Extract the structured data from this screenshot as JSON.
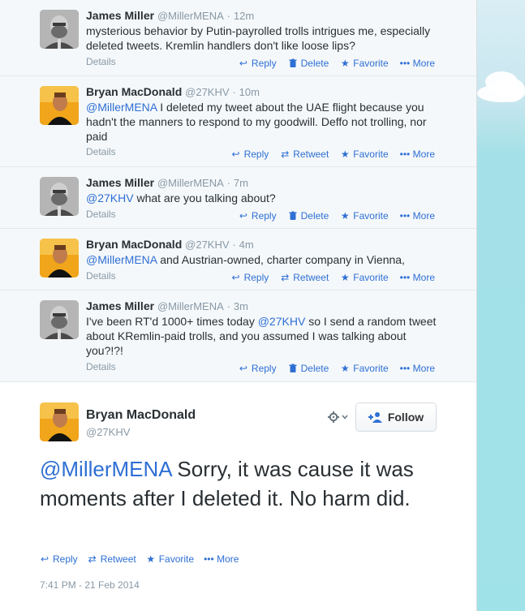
{
  "actions": {
    "reply": "Reply",
    "delete": "Delete",
    "retweet": "Retweet",
    "favorite": "Favorite",
    "more": "More",
    "details": "Details"
  },
  "replies": [
    {
      "name": "James Miller",
      "handle": "@MillerMENA",
      "time": "12m",
      "text": "mysterious behavior by Putin-payrolled trolls intrigues me, especially deleted tweets. Kremlin handlers don't like loose lips?",
      "mention": "",
      "actions": [
        "reply",
        "delete",
        "favorite",
        "more"
      ]
    },
    {
      "name": "Bryan MacDonald",
      "handle": "@27KHV",
      "time": "10m",
      "mention": "@MillerMENA",
      "text": "I deleted my tweet about the UAE flight because you hadn't the manners to respond to my goodwill. Deffo not trolling, nor paid",
      "actions": [
        "reply",
        "retweet",
        "favorite",
        "more"
      ]
    },
    {
      "name": "James Miller",
      "handle": "@MillerMENA",
      "time": "7m",
      "mention": "@27KHV",
      "text": "what are you talking about?",
      "actions": [
        "reply",
        "delete",
        "favorite",
        "more"
      ]
    },
    {
      "name": "Bryan MacDonald",
      "handle": "@27KHV",
      "time": "4m",
      "mention": "@MillerMENA",
      "text": "and Austrian-owned, charter company in Vienna,",
      "actions": [
        "reply",
        "retweet",
        "favorite",
        "more"
      ]
    },
    {
      "name": "James Miller",
      "handle": "@MillerMENA",
      "time": "3m",
      "mention": "",
      "text_before": "I've been RT'd 1000+ times today",
      "inline_mention": "@27KHV",
      "text_after": "so I send a random tweet about KRemlin-paid trolls, and you assumed I was talking about you?!?!",
      "actions": [
        "reply",
        "delete",
        "favorite",
        "more"
      ]
    }
  ],
  "main_tweet": {
    "name": "Bryan MacDonald",
    "handle": "@27KHV",
    "follow_label": "Follow",
    "mention": "@MillerMENA",
    "text": "Sorry, it was cause it was moments after I deleted it. No harm did.",
    "timestamp": "7:41 PM - 21 Feb 2014"
  },
  "colors": {
    "link": "#2e6fd4",
    "muted": "#8899a6",
    "text": "#292f33",
    "reply_bg": "#f5f8fa"
  }
}
